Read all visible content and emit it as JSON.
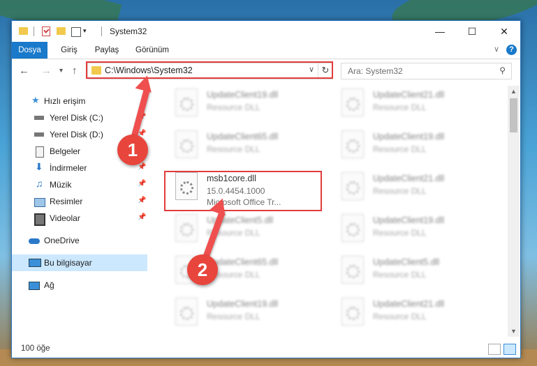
{
  "window": {
    "title": "System32"
  },
  "ribbon": {
    "tabs": [
      "Dosya",
      "Giriş",
      "Paylaş",
      "Görünüm"
    ],
    "help": "?"
  },
  "navigation": {
    "address": "C:\\Windows\\System32",
    "search_placeholder": "Ara: System32"
  },
  "sidebar": {
    "items": [
      {
        "label": "Hızlı erişim",
        "icon": "star-icon",
        "pinned": false
      },
      {
        "label": "Yerel Disk (C:)",
        "icon": "drive-icon",
        "pinned": true
      },
      {
        "label": "Yerel Disk (D:)",
        "icon": "drive-icon",
        "pinned": true
      },
      {
        "label": "Belgeler",
        "icon": "documents-icon",
        "pinned": true
      },
      {
        "label": "İndirmeler",
        "icon": "download-icon",
        "pinned": true
      },
      {
        "label": "Müzik",
        "icon": "music-icon",
        "pinned": true
      },
      {
        "label": "Resimler",
        "icon": "pictures-icon",
        "pinned": true
      },
      {
        "label": "Videolar",
        "icon": "videos-icon",
        "pinned": true
      },
      {
        "label": "OneDrive",
        "icon": "cloud-icon",
        "pinned": false
      },
      {
        "label": "Bu bilgisayar",
        "icon": "computer-icon",
        "pinned": false,
        "selected": true
      },
      {
        "label": "Ağ",
        "icon": "network-icon",
        "pinned": false
      }
    ]
  },
  "files": [
    {
      "name": "UpdateClient19.dll",
      "line2": "Resource DLL",
      "line3": ""
    },
    {
      "name": "UpdateClient21.dll",
      "line2": "Resource DLL",
      "line3": ""
    },
    {
      "name": "UpdateClient65.dll",
      "line2": "Resource DLL",
      "line3": ""
    },
    {
      "name": "UpdateClient19.dll",
      "line2": "Resource DLL",
      "line3": ""
    },
    {
      "name": "msb1core.dll",
      "line2": "15.0.4454.1000",
      "line3": "Microsoft Office Tr..."
    },
    {
      "name": "UpdateClient21.dll",
      "line2": "Resource DLL",
      "line3": ""
    },
    {
      "name": "UpdateClient5.dll",
      "line2": "Resource DLL",
      "line3": ""
    },
    {
      "name": "UpdateClient19.dll",
      "line2": "Resource DLL",
      "line3": ""
    },
    {
      "name": "UpdateClient65.dll",
      "line2": "Resource DLL",
      "line3": ""
    },
    {
      "name": "UpdateClient5.dll",
      "line2": "Resource DLL",
      "line3": ""
    },
    {
      "name": "UpdateClient19.dll",
      "line2": "Resource DLL",
      "line3": ""
    },
    {
      "name": "UpdateClient21.dll",
      "line2": "Resource DLL",
      "line3": ""
    }
  ],
  "status": {
    "count": "100 öğe"
  },
  "annotations": {
    "step1": "1",
    "step2": "2"
  },
  "colors": {
    "accent": "#1979ca",
    "highlight": "#e23b3b",
    "selected": "#cce8ff"
  }
}
